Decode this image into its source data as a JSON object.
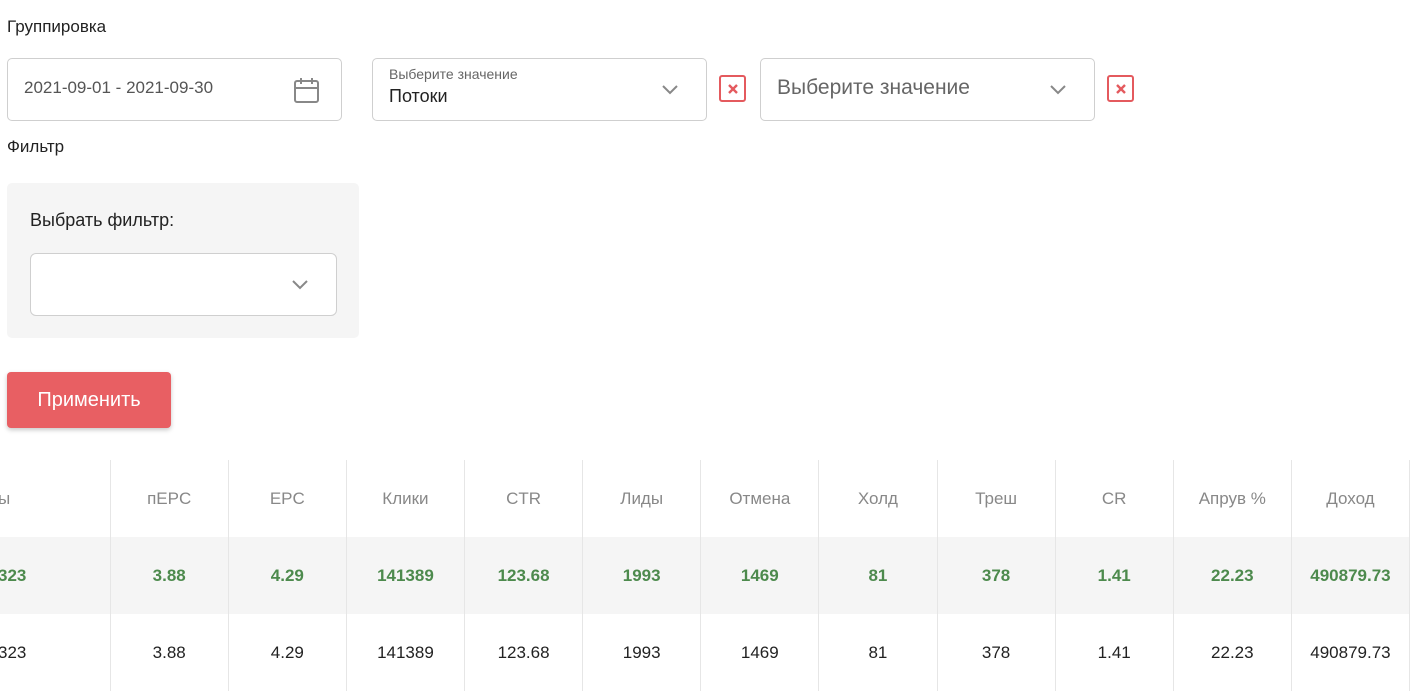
{
  "grouping": {
    "label": "Группировка",
    "date_range": "2021-09-01 - 2021-09-30",
    "group1": {
      "caption": "Выберите значение",
      "value": "Потоки"
    },
    "group2": {
      "placeholder": "Выберите значение"
    }
  },
  "filter": {
    "label": "Фильтр",
    "select_label": "Выбрать фильтр:",
    "select_value": ""
  },
  "apply_label": "Применить",
  "colors": {
    "accent": "#e85f63",
    "total_text": "#4d8a4d",
    "total_bg": "#f5f5f5"
  },
  "table": {
    "columns": [
      "ы",
      "пEPC",
      "EPC",
      "Клики",
      "CTR",
      "Лиды",
      "Отмена",
      "Холд",
      "Треш",
      "CR",
      "Апрув %",
      "Доход"
    ],
    "rows": [
      [
        "323",
        "3.88",
        "4.29",
        "141389",
        "123.68",
        "1993",
        "1469",
        "81",
        "378",
        "1.41",
        "22.23",
        "490879.73"
      ],
      [
        "323",
        "3.88",
        "4.29",
        "141389",
        "123.68",
        "1993",
        "1469",
        "81",
        "378",
        "1.41",
        "22.23",
        "490879.73"
      ]
    ]
  }
}
